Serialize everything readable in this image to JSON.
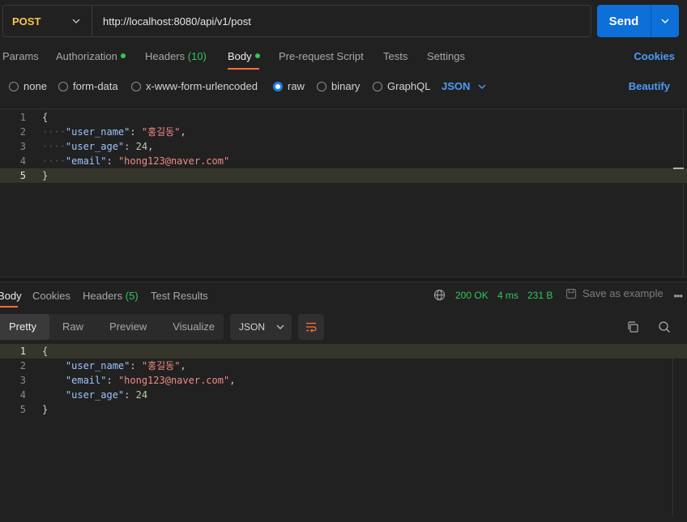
{
  "request": {
    "method": "POST",
    "url": "http://localhost:8080/api/v1/post",
    "send_label": "Send"
  },
  "request_tabs": {
    "params": "Params",
    "authorization": "Authorization",
    "headers": "Headers",
    "headers_count": "(10)",
    "body": "Body",
    "pre_request": "Pre-request Script",
    "tests": "Tests",
    "settings": "Settings",
    "cookies": "Cookies"
  },
  "body_types": {
    "none": "none",
    "form_data": "form-data",
    "urlencoded": "x-www-form-urlencoded",
    "raw": "raw",
    "binary": "binary",
    "graphql": "GraphQL",
    "format": "JSON",
    "beautify": "Beautify"
  },
  "request_body": {
    "line_numbers": [
      "1",
      "2",
      "3",
      "4",
      "5"
    ],
    "open_brace": "{",
    "close_brace": "}",
    "k1": "\"user_name\"",
    "v1": "\"홍길동\"",
    "k2": "\"user_age\"",
    "v2": "24",
    "k3": "\"email\"",
    "v3": "\"hong123@naver.com\""
  },
  "response_tabs": {
    "body": "Body",
    "cookies": "Cookies",
    "headers": "Headers",
    "headers_count": "(5)",
    "test_results": "Test Results",
    "status": "200 OK",
    "time": "4 ms",
    "size": "231 B",
    "save_example": "Save as example",
    "more": "•••"
  },
  "response_view": {
    "pretty": "Pretty",
    "raw": "Raw",
    "preview": "Preview",
    "visualize": "Visualize",
    "format": "JSON"
  },
  "response_body": {
    "line_numbers": [
      "1",
      "2",
      "3",
      "4",
      "5"
    ],
    "open_brace": "{",
    "close_brace": "}",
    "k1": "\"user_name\"",
    "v1": "\"홍길동\"",
    "k2": "\"email\"",
    "v2": "\"hong123@naver.com\"",
    "k3": "\"user_age\"",
    "v3": "24"
  },
  "colors": {
    "accent": "#0d6fd8",
    "method": "#f7c947",
    "status_ok": "#34c759",
    "tab_underline": "#ff6c37",
    "link": "#4b9cf5"
  }
}
